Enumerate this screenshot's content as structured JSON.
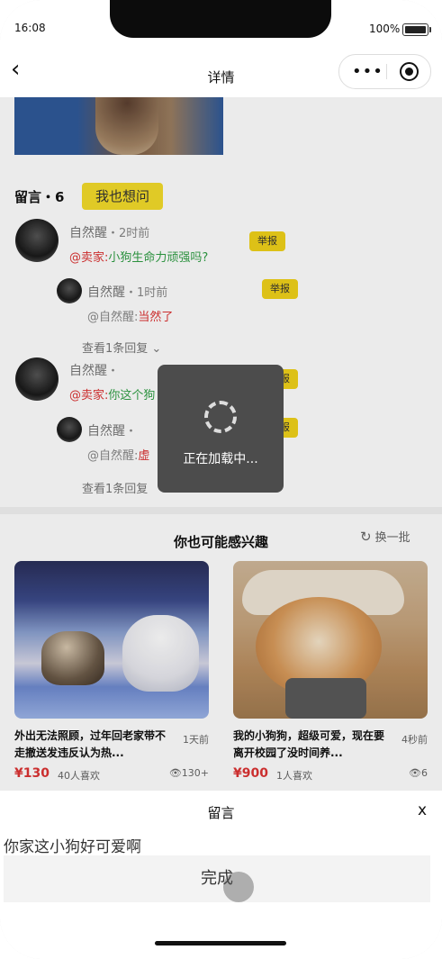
{
  "status_bar": {
    "time": "16:08",
    "battery": "100%"
  },
  "navbar": {
    "title": "详情",
    "back_icon": "‹",
    "more_icon": "•••"
  },
  "comments_section": {
    "title": "留言・6",
    "ask_button": "我也想问",
    "comments": [
      {
        "name": "自然醒",
        "time": "・2时前",
        "prefix": "@卖家:",
        "text": "小狗生命力顽强吗?",
        "report": "举报",
        "reply": {
          "name": "自然醒",
          "time": "・1时前",
          "prefix": "@自然醒:",
          "text": "当然了",
          "report": "举报"
        },
        "more": "查看1条回复"
      },
      {
        "name": "自然醒",
        "time": "・",
        "prefix": "@卖家:",
        "text": "你这个狗",
        "report": "举报",
        "reply": {
          "name": "自然醒",
          "time": "・",
          "prefix": "@自然醒:",
          "text": "虚",
          "report": "举报"
        },
        "more": "查看1条回复"
      }
    ]
  },
  "interest": {
    "title": "你也可能感兴趣",
    "refresh_label": "换一批",
    "cards": [
      {
        "title": "外出无法照顾，过年回老家带不走撤送发违反认为热...",
        "age": "1天前",
        "price": "¥130",
        "likes": "40人喜欢",
        "views": "130+"
      },
      {
        "title": "我的小狗狗，超级可爱，现在要离开校园了没时间养...",
        "age": "4秒前",
        "price": "¥900",
        "likes": "1人喜欢",
        "views": "6"
      }
    ]
  },
  "loading_toast": {
    "text": "正在加载中..."
  },
  "message_sheet": {
    "title": "留言",
    "close": "x",
    "input_value": "你家这小狗好可爱啊",
    "done_button": "完成"
  }
}
